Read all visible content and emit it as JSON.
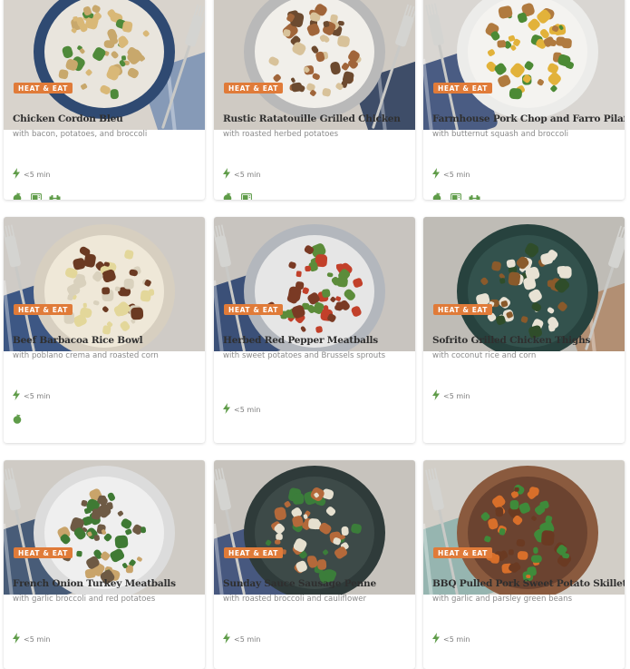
{
  "badge_label": "HEAT & EAT",
  "colors": {
    "badge": "#e07b39",
    "bolt": "#5f9c49",
    "title": "#2f2f2f",
    "subtitle": "#8a8a8a"
  },
  "meals": [
    {
      "title": "Chicken Cordon Bleu",
      "subtitle": "with bacon, potatoes, and broccoli",
      "time": "<5 min",
      "tags": [
        "apple-icon",
        "microwave-icon",
        "dumbbell-icon"
      ]
    },
    {
      "title": "Rustic Ratatouille Grilled Chicken",
      "subtitle": "with roasted herbed potatoes",
      "time": "<5 min",
      "tags": [
        "apple-icon",
        "microwave-icon"
      ]
    },
    {
      "title": "Farmhouse Pork Chop and Farro Pilaf",
      "subtitle": "with butternut squash and broccoli",
      "time": "<5 min",
      "tags": [
        "apple-icon",
        "microwave-icon",
        "dumbbell-icon"
      ]
    },
    {
      "title": "Beef Barbacoa Rice Bowl",
      "subtitle": "with poblano crema and roasted corn",
      "time": "<5 min",
      "tags": [
        "apple-icon"
      ]
    },
    {
      "title": "Herbed Red Pepper Meatballs",
      "subtitle": "with sweet potatoes and Brussels sprouts",
      "time": "<5 min",
      "tags": []
    },
    {
      "title": "Sofrito Grilled Chicken Thighs",
      "subtitle": "with coconut rice and corn",
      "time": "<5 min",
      "tags": []
    },
    {
      "title": "French Onion Turkey Meatballs",
      "subtitle": "with garlic broccoli and red potatoes",
      "time": "<5 min",
      "tags": []
    },
    {
      "title": "Sunday Sauce Sausage Penne",
      "subtitle": "with roasted broccoli and cauliflower",
      "time": "<5 min",
      "tags": []
    },
    {
      "title": "BBQ Pulled Pork Sweet Potato Skillet",
      "subtitle": "with garlic and parsley green beans",
      "time": "<5 min",
      "tags": []
    }
  ]
}
